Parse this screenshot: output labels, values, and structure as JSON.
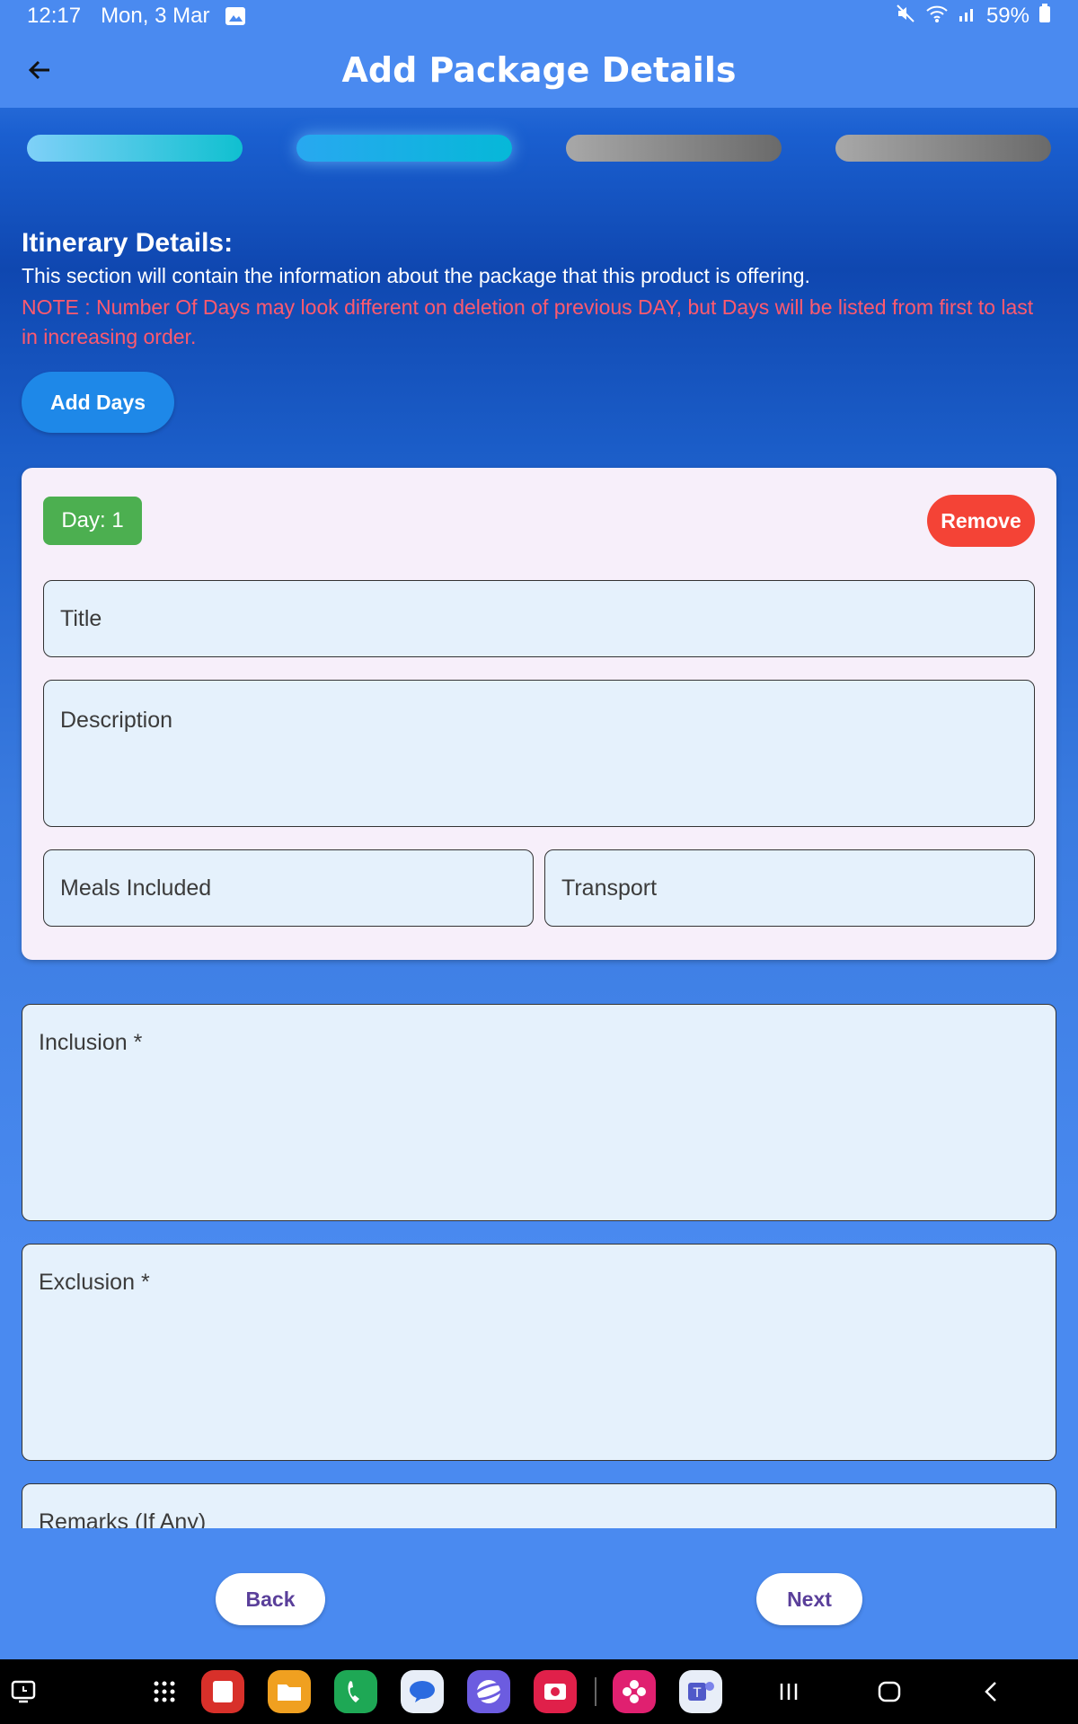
{
  "status_bar": {
    "time": "12:17",
    "date": "Mon, 3 Mar",
    "battery": "59%"
  },
  "appbar": {
    "title": "Add Package Details"
  },
  "stepper": {
    "steps": [
      "done",
      "active",
      "todo",
      "todo"
    ]
  },
  "section": {
    "title": "Itinerary Details:",
    "description": "This section will contain the information about the package that this product is offering.",
    "note": "NOTE : Number Of Days may look different on deletion of previous DAY, but Days will be listed from first to last in increasing order."
  },
  "add_days_label": "Add Days",
  "day_card": {
    "badge": "Day: 1",
    "remove_label": "Remove",
    "title_placeholder": "Title",
    "description_placeholder": "Description",
    "meals_placeholder": "Meals Included",
    "transport_placeholder": "Transport"
  },
  "inclusion_placeholder": "Inclusion *",
  "exclusion_placeholder": "Exclusion *",
  "remarks_placeholder": "Remarks (If Any)",
  "footer": {
    "back_label": "Back",
    "next_label": "Next"
  },
  "colors": {
    "appbar": "#4a8af0",
    "remove": "#f44336",
    "day_badge": "#4caf50",
    "note": "#ff5a6e",
    "add_days": "#1e88e8"
  }
}
